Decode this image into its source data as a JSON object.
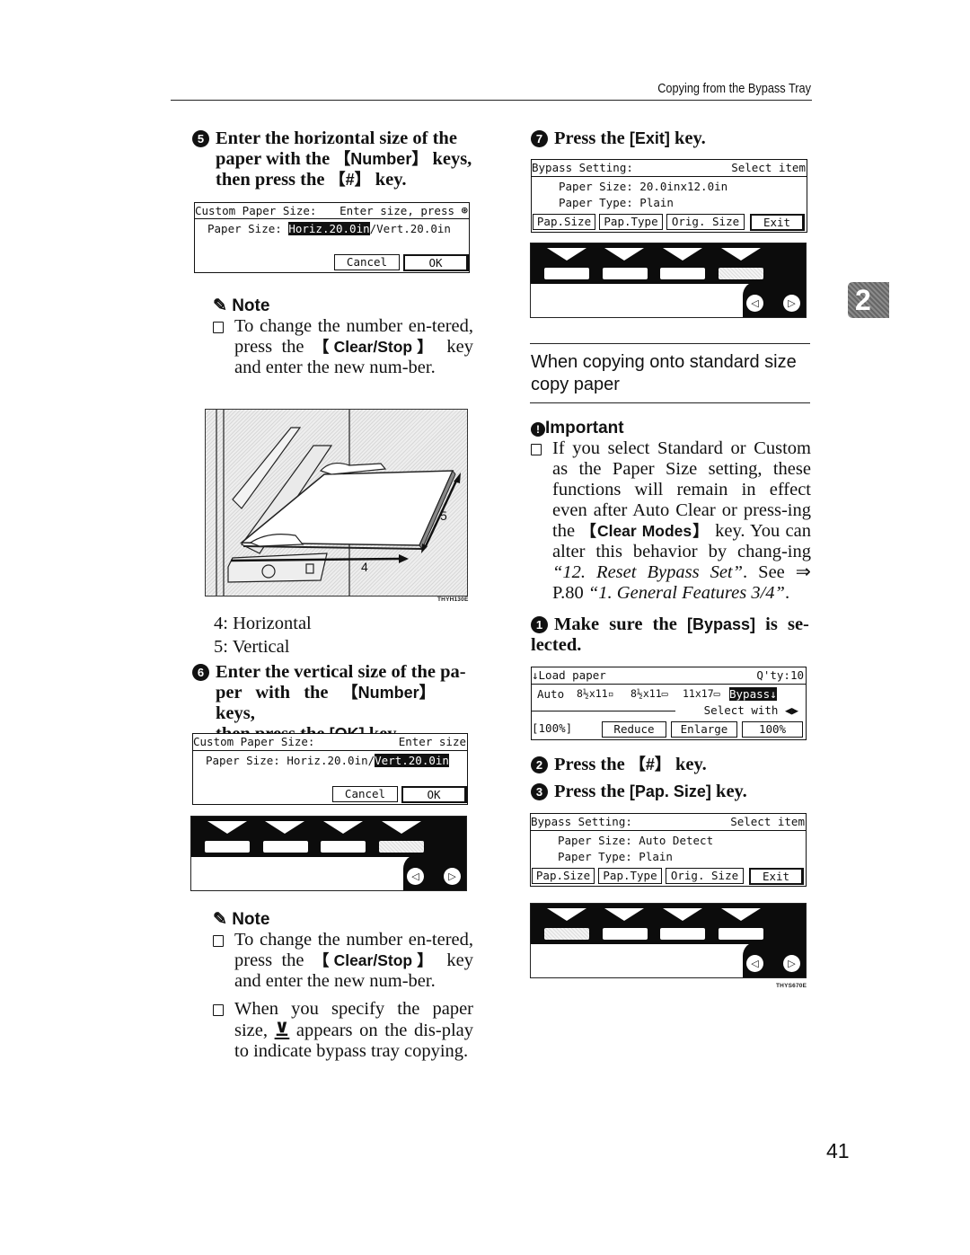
{
  "header": {
    "title": "Copying from the Bypass Tray"
  },
  "chapter_tab": "2",
  "page_number": "41",
  "left_column": {
    "step5": {
      "number": "5",
      "line1": "Enter the horizontal size of the",
      "line2_pre": "paper with the ",
      "line2_key": "【Number】",
      "line2_post": " keys,",
      "line3_pre": "then press the ",
      "line3_key": "【#】",
      "line3_post": " key."
    },
    "lcd_horiz": {
      "title": "Custom Paper Size:",
      "prompt": "Enter size, press",
      "prompt_icon": "hash-circle-icon",
      "prompt_glyph": "⊛",
      "size_label": "Paper Size: ",
      "horiz_value": "Horiz.20.0in",
      "separator": "/",
      "vert_value": "Vert.20.0in",
      "cancel": "Cancel",
      "ok": "OK"
    },
    "note1": {
      "heading": "Note",
      "text_pre": "To change the number en-tered, press the ",
      "text_key": "【Clear/Stop】",
      "text_post": " key and enter the new num-ber."
    },
    "illustration": {
      "label_horizontal": "4",
      "label_vertical": "5",
      "figure_id": "THYH130E"
    },
    "legend": [
      "4: Horizontal",
      "5: Vertical"
    ],
    "step6": {
      "number": "6",
      "line1": "Enter the vertical size of the pa-",
      "line2_pre": "per with the ",
      "line2_key": "【Number】",
      "line2_post": " keys,",
      "line3_pre": "then press the ",
      "line3_key": "[OK]",
      "line3_post": " key."
    },
    "lcd_vert": {
      "title": "Custom Paper Size:",
      "prompt": "Enter size",
      "size_label": "Paper Size: ",
      "horiz_value": "Horiz.20.0in",
      "separator": "/",
      "vert_value": "Vert.20.0in",
      "cancel": "Cancel",
      "ok": "OK"
    },
    "note2": {
      "heading": "Note",
      "item1_pre": "To change the number en-tered, press the ",
      "item1_key": "【Clear/Stop】",
      "item1_post": " key and enter the new num-ber.",
      "item2_pre": "When you specify the paper size, ",
      "item2_icon": "bypass-tray-icon",
      "item2_glyph": "⊻",
      "item2_post": " appears on the dis-play to indicate bypass tray copying."
    }
  },
  "right_column": {
    "step7": {
      "number": "7",
      "text_pre": "Press the ",
      "text_key": "[Exit]",
      "text_post": " key."
    },
    "lcd_bypass1": {
      "title": "Bypass Setting:",
      "prompt": "Select item",
      "line1": "Paper Size: 20.0inx12.0in",
      "line2": "Paper Type: Plain",
      "buttons": [
        "Pap.Size",
        "Pap.Type",
        "Orig. Size",
        "Exit"
      ]
    },
    "section_title": "When copying onto standard size copy paper",
    "important": {
      "heading": "Important",
      "text_pre": "If you select Standard or Custom as the Paper Size setting, these functions will remain in effect even after Auto Clear or press-ing the ",
      "text_key": "【Clear Modes】",
      "text_mid": " key. You can alter this behavior by chang-ing ",
      "text_ref1": "“12. Reset Bypass Set”",
      "text_see": ". See ⇒ P.80 ",
      "text_ref2": "“1. General Features 3/4”",
      "text_end": "."
    },
    "step1": {
      "number": "1",
      "text_pre": "Make sure the ",
      "text_key": "[Bypass]",
      "text_post": " is se-lected."
    },
    "lcd_copy": {
      "status": "Load paper",
      "status_icon": "down-arrow-icon",
      "qty": "Q'ty:10",
      "trays": [
        "Auto",
        "8½x11▫",
        "8½x11▭",
        "11x17▭"
      ],
      "bypass": "Bypass",
      "select_hint": "Select with ◀▶",
      "ratio": "[100%]",
      "buttons": [
        "Reduce",
        "Enlarge",
        "100%"
      ]
    },
    "step2": {
      "number": "2",
      "text_pre": "Press the ",
      "text_key": "【#】",
      "text_post": " key."
    },
    "step3": {
      "number": "3",
      "text_pre": "Press the ",
      "text_key": "[Pap. Size]",
      "text_post": " key."
    },
    "lcd_bypass2": {
      "title": "Bypass Setting:",
      "prompt": "Select item",
      "line1": "Paper Size: Auto Detect",
      "line2": "Paper Type: Plain",
      "buttons": [
        "Pap.Size",
        "Pap.Type",
        "Orig. Size",
        "Exit"
      ]
    },
    "panel_figure_id": "THYS670E"
  },
  "panel_keys": {
    "left_arrow": "◁",
    "right_arrow": "▷"
  }
}
